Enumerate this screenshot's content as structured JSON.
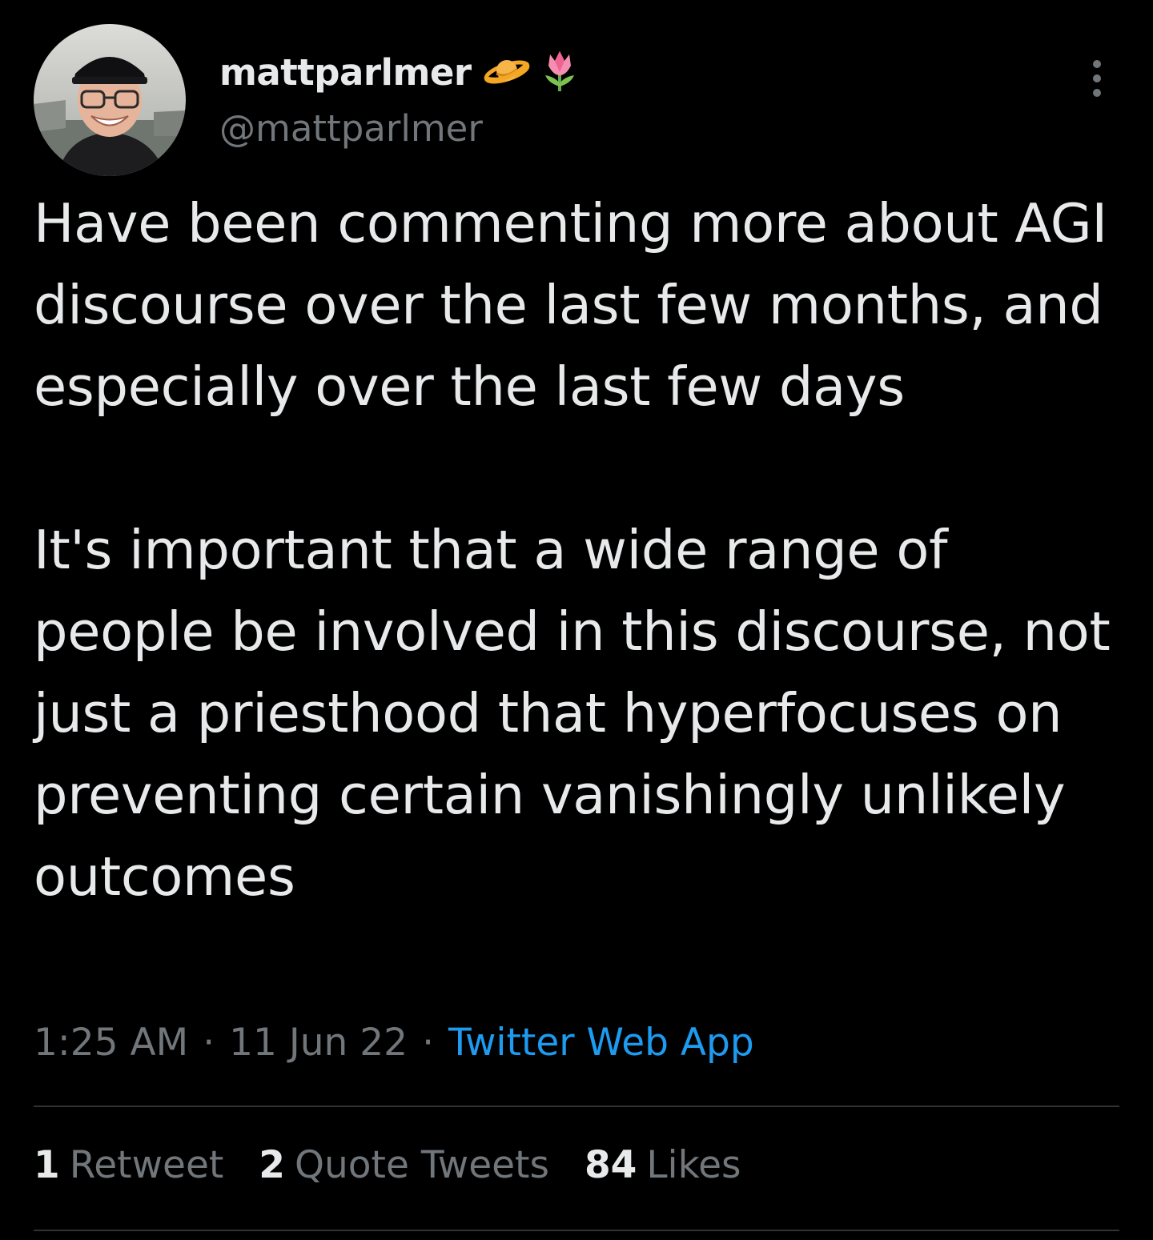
{
  "author": {
    "display_name": "mattparlmer",
    "handle": "@mattparlmer",
    "name_emojis": [
      "ringed-planet-icon",
      "tulip-icon"
    ]
  },
  "tweet": {
    "paragraphs": [
      "Have been commenting more about AGI discourse over the last few months, and especially over the last few days",
      "It's important that a wide range of people be involved in this discourse, not just a priesthood that hyperfocuses on preventing certain vanishingly unlikely outcomes"
    ],
    "time": "1:25 AM",
    "date": "11 Jun 22",
    "separator": "·",
    "source": "Twitter Web App"
  },
  "stats": {
    "retweets": {
      "count": "1",
      "label": "Retweet"
    },
    "quotes": {
      "count": "2",
      "label": "Quote Tweets"
    },
    "likes": {
      "count": "84",
      "label": "Likes"
    }
  },
  "colors": {
    "background": "#000000",
    "text_primary": "#e7e9ea",
    "text_secondary": "#71767b",
    "link": "#1d9bf0",
    "divider": "#2f3336"
  }
}
